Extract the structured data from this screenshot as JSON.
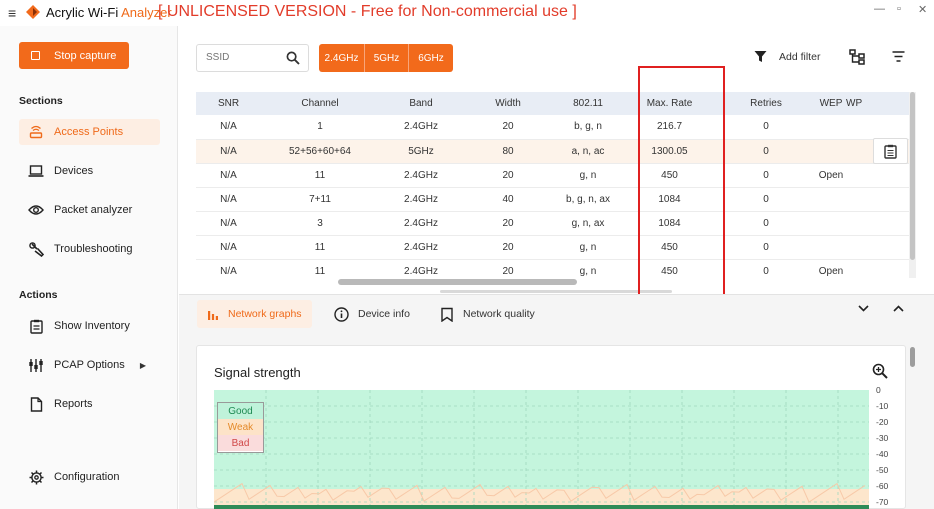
{
  "app": {
    "title_prefix": "Acrylic Wi-Fi ",
    "title_accent": "Analyzer",
    "license_notice": "[ UNLICENSED VERSION - Free for Non-commercial use ]",
    "window_controls": {
      "minimize": "—",
      "maximize": "▫",
      "close": "✕"
    },
    "accent_color": "#f26a1b"
  },
  "sidebar": {
    "stop_capture": "Stop capture",
    "sections_heading": "Sections",
    "sections": [
      {
        "label": "Access Points",
        "icon": "router-icon",
        "active": true
      },
      {
        "label": "Devices",
        "icon": "laptop-icon"
      },
      {
        "label": "Packet analyzer",
        "icon": "eye-icon"
      },
      {
        "label": "Troubleshooting",
        "icon": "wrench-icon"
      }
    ],
    "actions_heading": "Actions",
    "actions": [
      {
        "label": "Show Inventory",
        "icon": "inventory-icon"
      },
      {
        "label": "PCAP Options",
        "icon": "pcap-icon",
        "has_submenu": true
      },
      {
        "label": "Reports",
        "icon": "document-icon"
      }
    ],
    "configuration": "Configuration"
  },
  "toolbar": {
    "ssid_placeholder": "SSID",
    "bands": [
      "2.4GHz",
      "5GHz",
      "6GHz"
    ],
    "add_filter": "Add filter"
  },
  "table": {
    "columns": [
      "SNR",
      "Channel",
      "Band",
      "Width",
      "802.11",
      "Max. Rate",
      "Retries",
      "WEP",
      "WP"
    ],
    "rows": [
      [
        "N/A",
        "1",
        "2.4GHz",
        "20",
        "b, g, n",
        "216.7",
        "0",
        "",
        ""
      ],
      [
        "N/A",
        "52+56+60+64",
        "5GHz",
        "80",
        "a, n, ac",
        "1300.05",
        "0",
        "",
        ""
      ],
      [
        "N/A",
        "11",
        "2.4GHz",
        "20",
        "g, n",
        "450",
        "0",
        "Open",
        ""
      ],
      [
        "N/A",
        "7+11",
        "2.4GHz",
        "40",
        "b, g, n, ax",
        "1084",
        "0",
        "",
        ""
      ],
      [
        "N/A",
        "3",
        "2.4GHz",
        "20",
        "g, n, ax",
        "1084",
        "0",
        "",
        ""
      ],
      [
        "N/A",
        "11",
        "2.4GHz",
        "20",
        "g, n",
        "450",
        "0",
        "",
        ""
      ],
      [
        "N/A",
        "11",
        "2.4GHz",
        "20",
        "g, n",
        "450",
        "0",
        "Open",
        ""
      ]
    ],
    "selected_row": 1
  },
  "tabs": [
    {
      "label": "Network graphs",
      "active": true,
      "icon": "bar-chart-icon"
    },
    {
      "label": "Device info",
      "icon": "info-icon"
    },
    {
      "label": "Network quality",
      "icon": "bookmark-icon"
    }
  ],
  "graph": {
    "title": "Signal strength",
    "y_ticks": [
      "0",
      "-10",
      "-20",
      "-30",
      "-40",
      "-50",
      "-60",
      "-70"
    ],
    "legend": [
      "Good",
      "Weak",
      "Bad"
    ],
    "zone_colors": {
      "good": "#c4f5dd",
      "weak": "#fde6cc",
      "bad": "#fadcdc"
    }
  }
}
